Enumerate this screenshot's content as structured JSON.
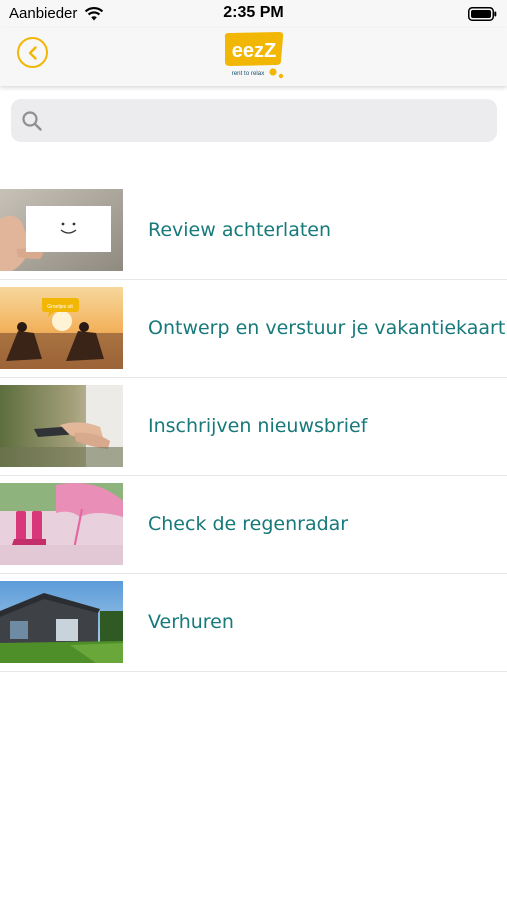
{
  "status_bar": {
    "carrier": "Aanbieder",
    "time": "2:35 PM",
    "icons": [
      "wifi-icon",
      "battery-icon"
    ]
  },
  "nav": {
    "back_icon": "chevron-left-icon",
    "logo": {
      "text": "eezZ",
      "tagline": "rent to relax"
    }
  },
  "search": {
    "placeholder": "",
    "value": "",
    "icon": "search-icon"
  },
  "menu": [
    {
      "label": "Review achterlaten",
      "image": "hand-holding-smiley-card"
    },
    {
      "label": "Ontwerp en verstuur je vakantiekaart",
      "image": "two-people-in-beach-chairs-at-sunset",
      "bubble_text": "Groetjes uit"
    },
    {
      "label": "Inschrijven nieuwsbrief",
      "image": "hand-holding-smartphone"
    },
    {
      "label": "Check de regenradar",
      "image": "pink-boots-and-umbrella"
    },
    {
      "label": "Verhuren",
      "image": "holiday-chalet-with-lawn"
    }
  ],
  "colors": {
    "accent": "#f2b705",
    "label": "#17797a",
    "nav_bg": "#f7f7f7",
    "search_bg": "#ececee",
    "divider": "#e6e6e6"
  }
}
